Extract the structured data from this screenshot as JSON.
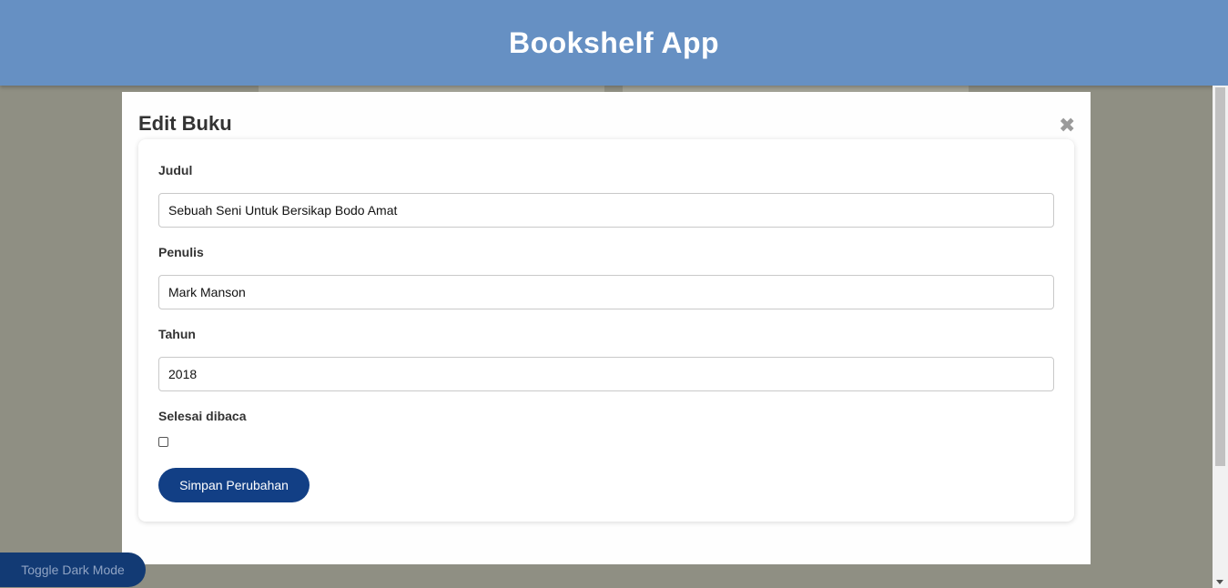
{
  "header": {
    "title": "Bookshelf App"
  },
  "modal": {
    "title": "Edit Buku",
    "close_icon": "close-icon",
    "close_glyph": "✖",
    "fields": {
      "judul": {
        "label": "Judul",
        "value": "Sebuah Seni Untuk Bersikap Bodo Amat"
      },
      "penulis": {
        "label": "Penulis",
        "value": "Mark Manson"
      },
      "tahun": {
        "label": "Tahun",
        "value": "2018"
      },
      "selesai": {
        "label": "Selesai dibaca",
        "checked": false
      }
    },
    "save_label": "Simpan Perubahan"
  },
  "toggle_dark_label": "Toggle Dark Mode",
  "colors": {
    "header_bg": "#6690c3",
    "overlay": "#8f8f83",
    "primary_button": "#123f85"
  }
}
